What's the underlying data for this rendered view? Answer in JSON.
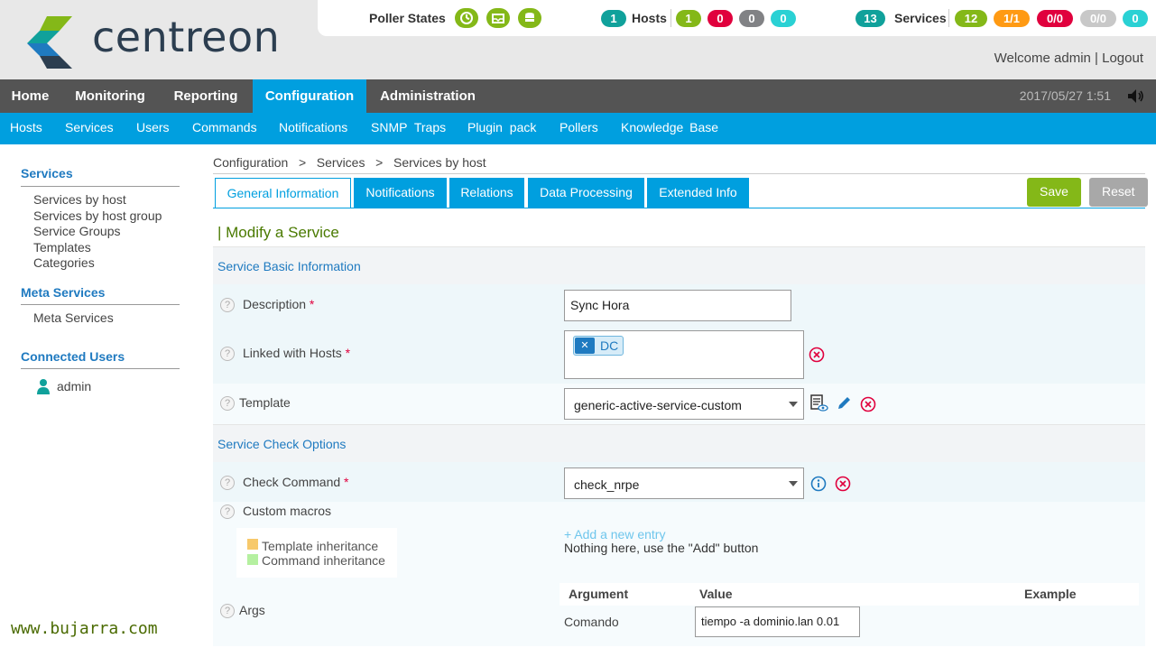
{
  "brand": {
    "name": "centreon"
  },
  "status": {
    "poller_label": "Poller States",
    "hosts_label": "Hosts",
    "hosts_counts": [
      "1",
      "1",
      "0",
      "0",
      "0"
    ],
    "services_label": "Services",
    "services_counts": [
      "13",
      "12",
      "1/1",
      "0/0",
      "0/0",
      "0"
    ]
  },
  "user": {
    "welcome": "Welcome admin | Logout"
  },
  "nav": {
    "items": [
      "Home",
      "Monitoring",
      "Reporting",
      "Configuration",
      "Administration"
    ],
    "active": "Configuration",
    "datetime": "2017/05/27 1:51"
  },
  "subnav": {
    "items": [
      "Hosts",
      "Services",
      "Users",
      "Commands",
      "Notifications",
      "SNMP Traps",
      "Plugin pack",
      "Pollers",
      "Knowledge Base"
    ]
  },
  "sidebar": {
    "services_head": "Services",
    "services_items": [
      "Services by host",
      "Services by host group",
      "Service Groups",
      "Templates",
      "Categories"
    ],
    "meta_head": "Meta Services",
    "meta_items": [
      "Meta Services"
    ],
    "connected_head": "Connected Users",
    "connected_user": "admin"
  },
  "breadcrumb": {
    "text": "Configuration   >   Services   >   Services by host"
  },
  "tabs": [
    "General Information",
    "Notifications",
    "Relations",
    "Data Processing",
    "Extended Info"
  ],
  "buttons": {
    "save": "Save",
    "reset": "Reset"
  },
  "page_title": "| Modify a Service",
  "sections": {
    "basic": "Service Basic Information",
    "check": "Service Check Options"
  },
  "form": {
    "description_label": "Description",
    "description_value": "Sync Hora",
    "linked_hosts_label": "Linked with Hosts",
    "linked_host_tag": "DC",
    "template_label": "Template",
    "template_value": "generic-active-service-custom",
    "check_command_label": "Check Command",
    "check_command_value": "check_nrpe",
    "custom_macros_label": "Custom macros",
    "legend_template": "Template inheritance",
    "legend_command": "Command inheritance",
    "add_entry": "+ Add a new entry",
    "nothing_here": "Nothing here, use the \"Add\" button",
    "args_label": "Args",
    "args_headers": [
      "Argument",
      "Value",
      "Example"
    ],
    "args_rows": [
      {
        "argument": "Comando",
        "value": "tiempo -a dominio.lan 0.01"
      }
    ],
    "required_mark": "*"
  },
  "watermark": "www.bujarra.com",
  "colors": {
    "accent": "#009fdf",
    "ok": "#84b818",
    "critical": "#e0003d",
    "warning": "#ff9a13",
    "unknown": "#818285",
    "pending": "#2ad1d4",
    "total": "#10a19b"
  }
}
